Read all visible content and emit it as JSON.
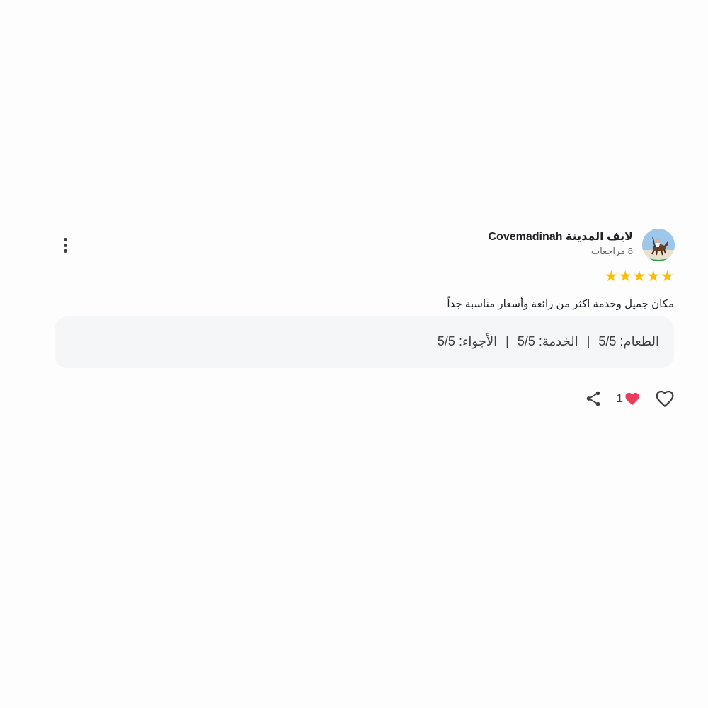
{
  "review": {
    "author": {
      "name": "لايف المدينة Covemadinah",
      "reviews_count": "8 مراجعات",
      "avatar_icon": "horse-rider-avatar-icon"
    },
    "rating": {
      "stars": 5,
      "max": 5,
      "star_glyph": "★",
      "color": "#fbbc04"
    },
    "text": "مكان جميل وخدمة اكثر من رائعة وأسعار مناسبة جداً",
    "sub_ratings": [
      {
        "text": "الطعام: 5/5"
      },
      {
        "text": "الخدمة: 5/5"
      },
      {
        "text": "الأجواء: 5/5"
      }
    ],
    "separator": "|",
    "actions": {
      "like_count": "1",
      "heart_color": "#ee3a5b",
      "share_icon": "share-icon",
      "like_icon": "heart-outline-icon"
    }
  }
}
